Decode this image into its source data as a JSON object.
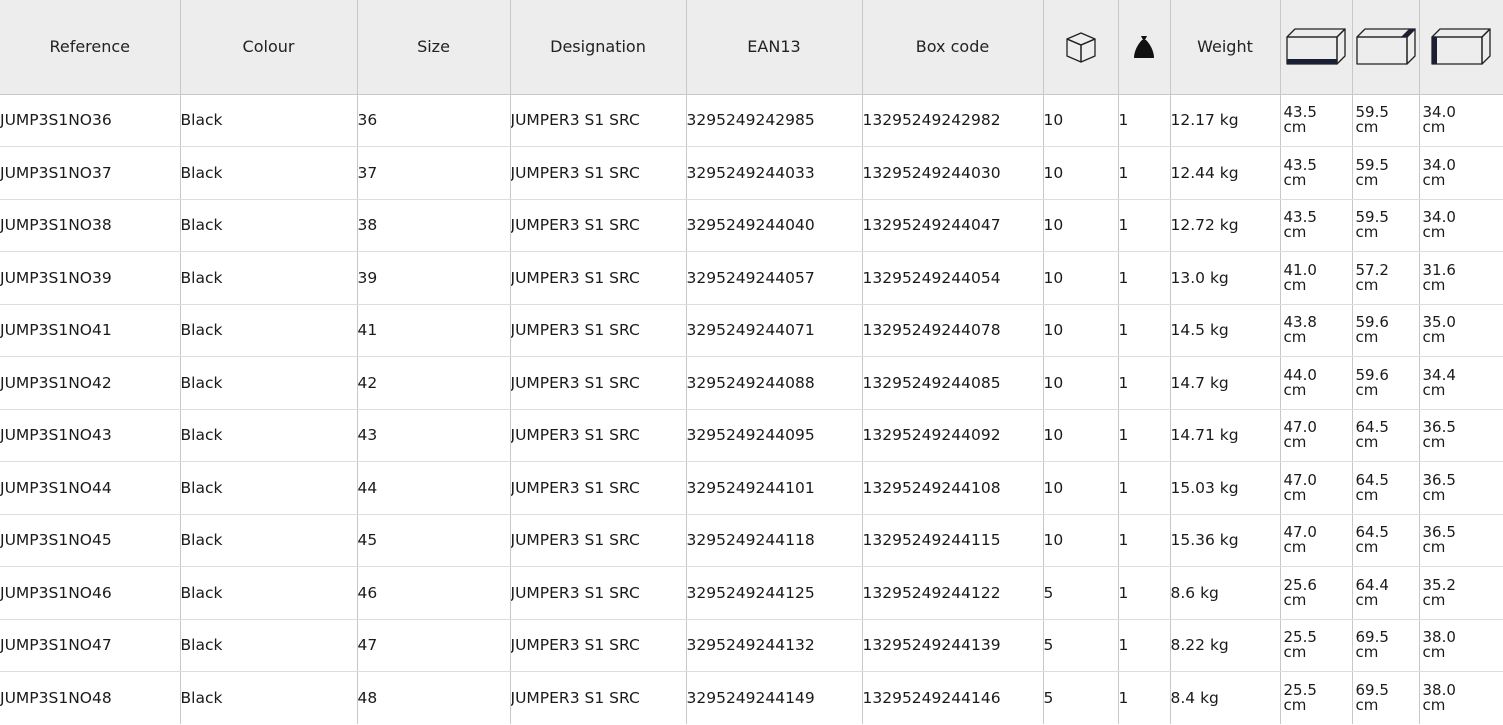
{
  "headers": {
    "reference": "Reference",
    "colour": "Colour",
    "size": "Size",
    "designation": "Designation",
    "ean13": "EAN13",
    "box_code": "Box code",
    "weight": "Weight"
  },
  "icons": {
    "box_quantity": "box-icon",
    "bag_quantity": "bag-icon",
    "box_length": "box-length-icon",
    "box_width": "box-width-icon",
    "box_height": "box-height-icon"
  },
  "rows": [
    {
      "reference": "JUMP3S1NO36",
      "colour": "Black",
      "size": "36",
      "designation": "JUMPER3 S1 SRC",
      "ean13": "3295249242985",
      "box_code": "13295249242982",
      "box_qty": "10",
      "bag_qty": "1",
      "weight": "12.17 kg",
      "length": "43.5",
      "width": "59.5",
      "height": "34.0",
      "unit": "cm"
    },
    {
      "reference": "JUMP3S1NO37",
      "colour": "Black",
      "size": "37",
      "designation": "JUMPER3 S1 SRC",
      "ean13": "3295249244033",
      "box_code": "13295249244030",
      "box_qty": "10",
      "bag_qty": "1",
      "weight": "12.44 kg",
      "length": "43.5",
      "width": "59.5",
      "height": "34.0",
      "unit": "cm"
    },
    {
      "reference": "JUMP3S1NO38",
      "colour": "Black",
      "size": "38",
      "designation": "JUMPER3 S1 SRC",
      "ean13": "3295249244040",
      "box_code": "13295249244047",
      "box_qty": "10",
      "bag_qty": "1",
      "weight": "12.72 kg",
      "length": "43.5",
      "width": "59.5",
      "height": "34.0",
      "unit": "cm"
    },
    {
      "reference": "JUMP3S1NO39",
      "colour": "Black",
      "size": "39",
      "designation": "JUMPER3 S1 SRC",
      "ean13": "3295249244057",
      "box_code": "13295249244054",
      "box_qty": "10",
      "bag_qty": "1",
      "weight": "13.0 kg",
      "length": "41.0",
      "width": "57.2",
      "height": "31.6",
      "unit": "cm"
    },
    {
      "reference": "JUMP3S1NO41",
      "colour": "Black",
      "size": "41",
      "designation": "JUMPER3 S1 SRC",
      "ean13": "3295249244071",
      "box_code": "13295249244078",
      "box_qty": "10",
      "bag_qty": "1",
      "weight": "14.5 kg",
      "length": "43.8",
      "width": "59.6",
      "height": "35.0",
      "unit": "cm"
    },
    {
      "reference": "JUMP3S1NO42",
      "colour": "Black",
      "size": "42",
      "designation": "JUMPER3 S1 SRC",
      "ean13": "3295249244088",
      "box_code": "13295249244085",
      "box_qty": "10",
      "bag_qty": "1",
      "weight": "14.7 kg",
      "length": "44.0",
      "width": "59.6",
      "height": "34.4",
      "unit": "cm"
    },
    {
      "reference": "JUMP3S1NO43",
      "colour": "Black",
      "size": "43",
      "designation": "JUMPER3 S1 SRC",
      "ean13": "3295249244095",
      "box_code": "13295249244092",
      "box_qty": "10",
      "bag_qty": "1",
      "weight": "14.71 kg",
      "length": "47.0",
      "width": "64.5",
      "height": "36.5",
      "unit": "cm"
    },
    {
      "reference": "JUMP3S1NO44",
      "colour": "Black",
      "size": "44",
      "designation": "JUMPER3 S1 SRC",
      "ean13": "3295249244101",
      "box_code": "13295249244108",
      "box_qty": "10",
      "bag_qty": "1",
      "weight": "15.03 kg",
      "length": "47.0",
      "width": "64.5",
      "height": "36.5",
      "unit": "cm"
    },
    {
      "reference": "JUMP3S1NO45",
      "colour": "Black",
      "size": "45",
      "designation": "JUMPER3 S1 SRC",
      "ean13": "3295249244118",
      "box_code": "13295249244115",
      "box_qty": "10",
      "bag_qty": "1",
      "weight": "15.36 kg",
      "length": "47.0",
      "width": "64.5",
      "height": "36.5",
      "unit": "cm"
    },
    {
      "reference": "JUMP3S1NO46",
      "colour": "Black",
      "size": "46",
      "designation": "JUMPER3 S1 SRC",
      "ean13": "3295249244125",
      "box_code": "13295249244122",
      "box_qty": "5",
      "bag_qty": "1",
      "weight": "8.6 kg",
      "length": "25.6",
      "width": "64.4",
      "height": "35.2",
      "unit": "cm"
    },
    {
      "reference": "JUMP3S1NO47",
      "colour": "Black",
      "size": "47",
      "designation": "JUMPER3 S1 SRC",
      "ean13": "3295249244132",
      "box_code": "13295249244139",
      "box_qty": "5",
      "bag_qty": "1",
      "weight": "8.22 kg",
      "length": "25.5",
      "width": "69.5",
      "height": "38.0",
      "unit": "cm"
    },
    {
      "reference": "JUMP3S1NO48",
      "colour": "Black",
      "size": "48",
      "designation": "JUMPER3 S1 SRC",
      "ean13": "3295249244149",
      "box_code": "13295249244146",
      "box_qty": "5",
      "bag_qty": "1",
      "weight": "8.4 kg",
      "length": "25.5",
      "width": "69.5",
      "height": "38.0",
      "unit": "cm"
    }
  ]
}
